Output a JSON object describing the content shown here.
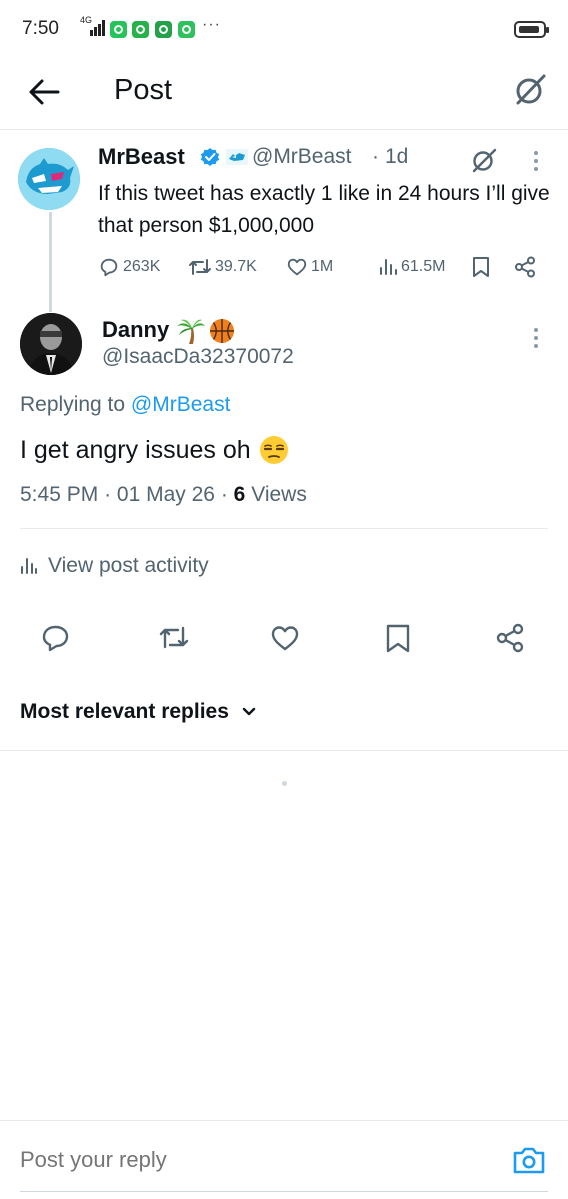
{
  "status_bar": {
    "time": "7:50",
    "network": "4G",
    "more": "···"
  },
  "header": {
    "title": "Post"
  },
  "parent_post": {
    "display_name": "MrBeast",
    "handle": "@MrBeast",
    "separator": "·",
    "time": "1d",
    "text": "If this tweet has exactly 1 like in 24 hours I’ll give that person $1,000,000",
    "metrics": {
      "replies": "263K",
      "reposts": "39.7K",
      "likes": "1M",
      "views": "61.5M"
    }
  },
  "post": {
    "display_name": "Danny",
    "name_emojis": [
      "palm-tree",
      "basketball"
    ],
    "handle": "@IsaacDa32370072",
    "replying_prefix": "Replying to",
    "replying_to": "@MrBeast",
    "text": "I get angry issues oh",
    "text_emoji": "unamused-face",
    "time": "5:45 PM",
    "date": "01 May 26",
    "views_count": "6",
    "views_label": "Views",
    "dot": "·"
  },
  "activity": {
    "label": "View post activity"
  },
  "replies": {
    "sort_label": "Most relevant replies"
  },
  "compose": {
    "placeholder": "Post your reply"
  },
  "colors": {
    "text": "#0f1419",
    "secondary": "#536471",
    "accent": "#1d9bf0",
    "divider": "#e7e9ea",
    "verified": "#1d9bf0"
  }
}
